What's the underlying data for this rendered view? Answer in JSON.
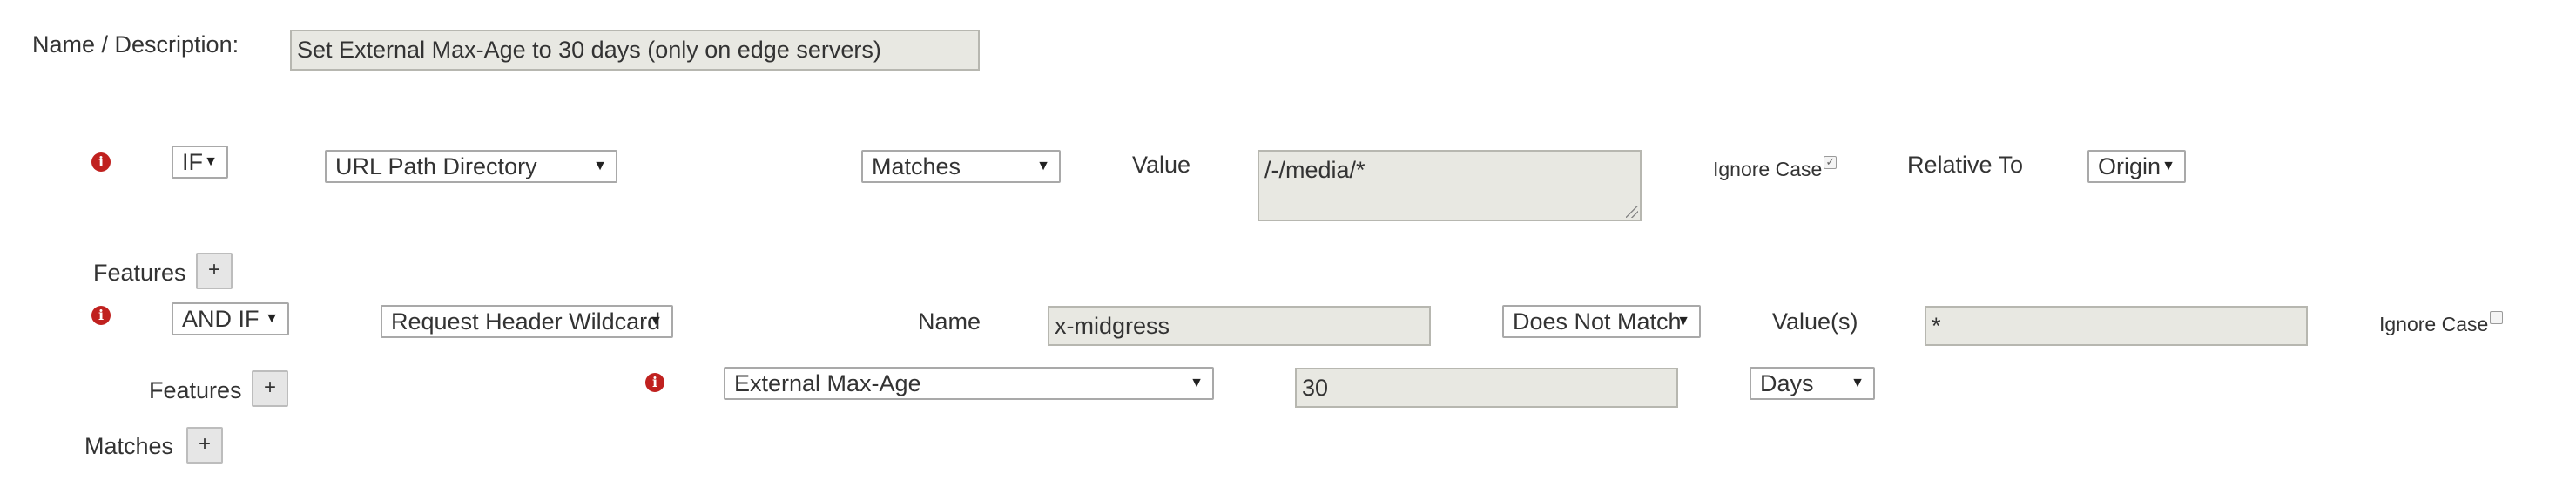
{
  "header": {
    "name_label": "Name / Description:",
    "name_value": "Set External Max-Age to 30 days (only on edge servers)"
  },
  "condition_if": {
    "info_icon": "info-icon",
    "operator": "IF",
    "match_type": "URL Path Directory",
    "comparison": "Matches",
    "value_label": "Value",
    "value_text": "/-/media/*",
    "ignore_case_label": "Ignore Case",
    "ignore_case_checked": true,
    "relative_to_label": "Relative To",
    "relative_to_value": "Origin"
  },
  "features_1": {
    "label": "Features",
    "add": "+"
  },
  "condition_and_if": {
    "info_icon": "info-icon",
    "operator": "AND IF",
    "match_type": "Request Header Wildcard",
    "name_label": "Name",
    "name_value": "x-midgress",
    "comparison": "Does Not Match",
    "values_label": "Value(s)",
    "values_text": "*",
    "ignore_case_label": "Ignore Case",
    "ignore_case_checked": false
  },
  "features_2": {
    "label": "Features",
    "add": "+",
    "info_icon": "info-icon",
    "feature": "External Max-Age",
    "amount": "30",
    "unit": "Days"
  },
  "matches": {
    "label": "Matches",
    "add": "+"
  },
  "colors": {
    "info_red": "#c0211f",
    "field_bg": "#e8e8e2",
    "text": "#333333"
  }
}
